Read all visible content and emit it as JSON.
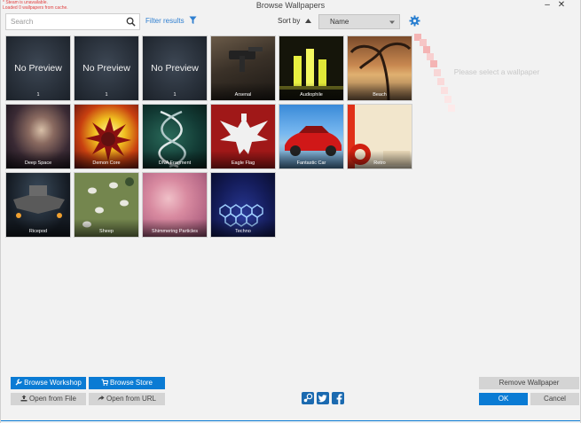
{
  "window": {
    "title": "Browse Wallpapers",
    "notice_lines": [
      "* Steam is unavailable.",
      "Loaded 0 wallpapers from cache."
    ],
    "minimize_glyph": "–",
    "close_glyph": "✕"
  },
  "toolbar": {
    "search_placeholder": "Search",
    "filter_label": "Filter results",
    "sort_label": "Sort by",
    "sort_value": "Name"
  },
  "wallpapers": [
    {
      "title": "1",
      "preview": "No Preview"
    },
    {
      "title": "1",
      "preview": "No Preview"
    },
    {
      "title": "1",
      "preview": "No Preview"
    },
    {
      "title": "Arsenal"
    },
    {
      "title": "Audiophile"
    },
    {
      "title": "Beach"
    },
    {
      "title": "Deep Space"
    },
    {
      "title": "Demon Core"
    },
    {
      "title": "DNA Fragment"
    },
    {
      "title": "Eagle Flag"
    },
    {
      "title": "Fantastic Car"
    },
    {
      "title": "Retro"
    },
    {
      "title": "Ricepod"
    },
    {
      "title": "Sheep"
    },
    {
      "title": "Shimmering Particles"
    },
    {
      "title": "Techno"
    }
  ],
  "preview": {
    "message": "Please select a wallpaper"
  },
  "buttons": {
    "browse_workshop": "Browse Workshop",
    "browse_store": "Browse Store",
    "open_from_file": "Open from File",
    "open_from_url": "Open from URL",
    "remove_wallpaper": "Remove Wallpaper",
    "ok": "OK",
    "cancel": "Cancel"
  },
  "social": [
    "steam-icon",
    "twitter-icon",
    "facebook-icon"
  ],
  "colors": {
    "accent": "#0a7bd4",
    "link": "#2f7fd0",
    "notice": "#e04040",
    "background": "#f2f2f2"
  }
}
